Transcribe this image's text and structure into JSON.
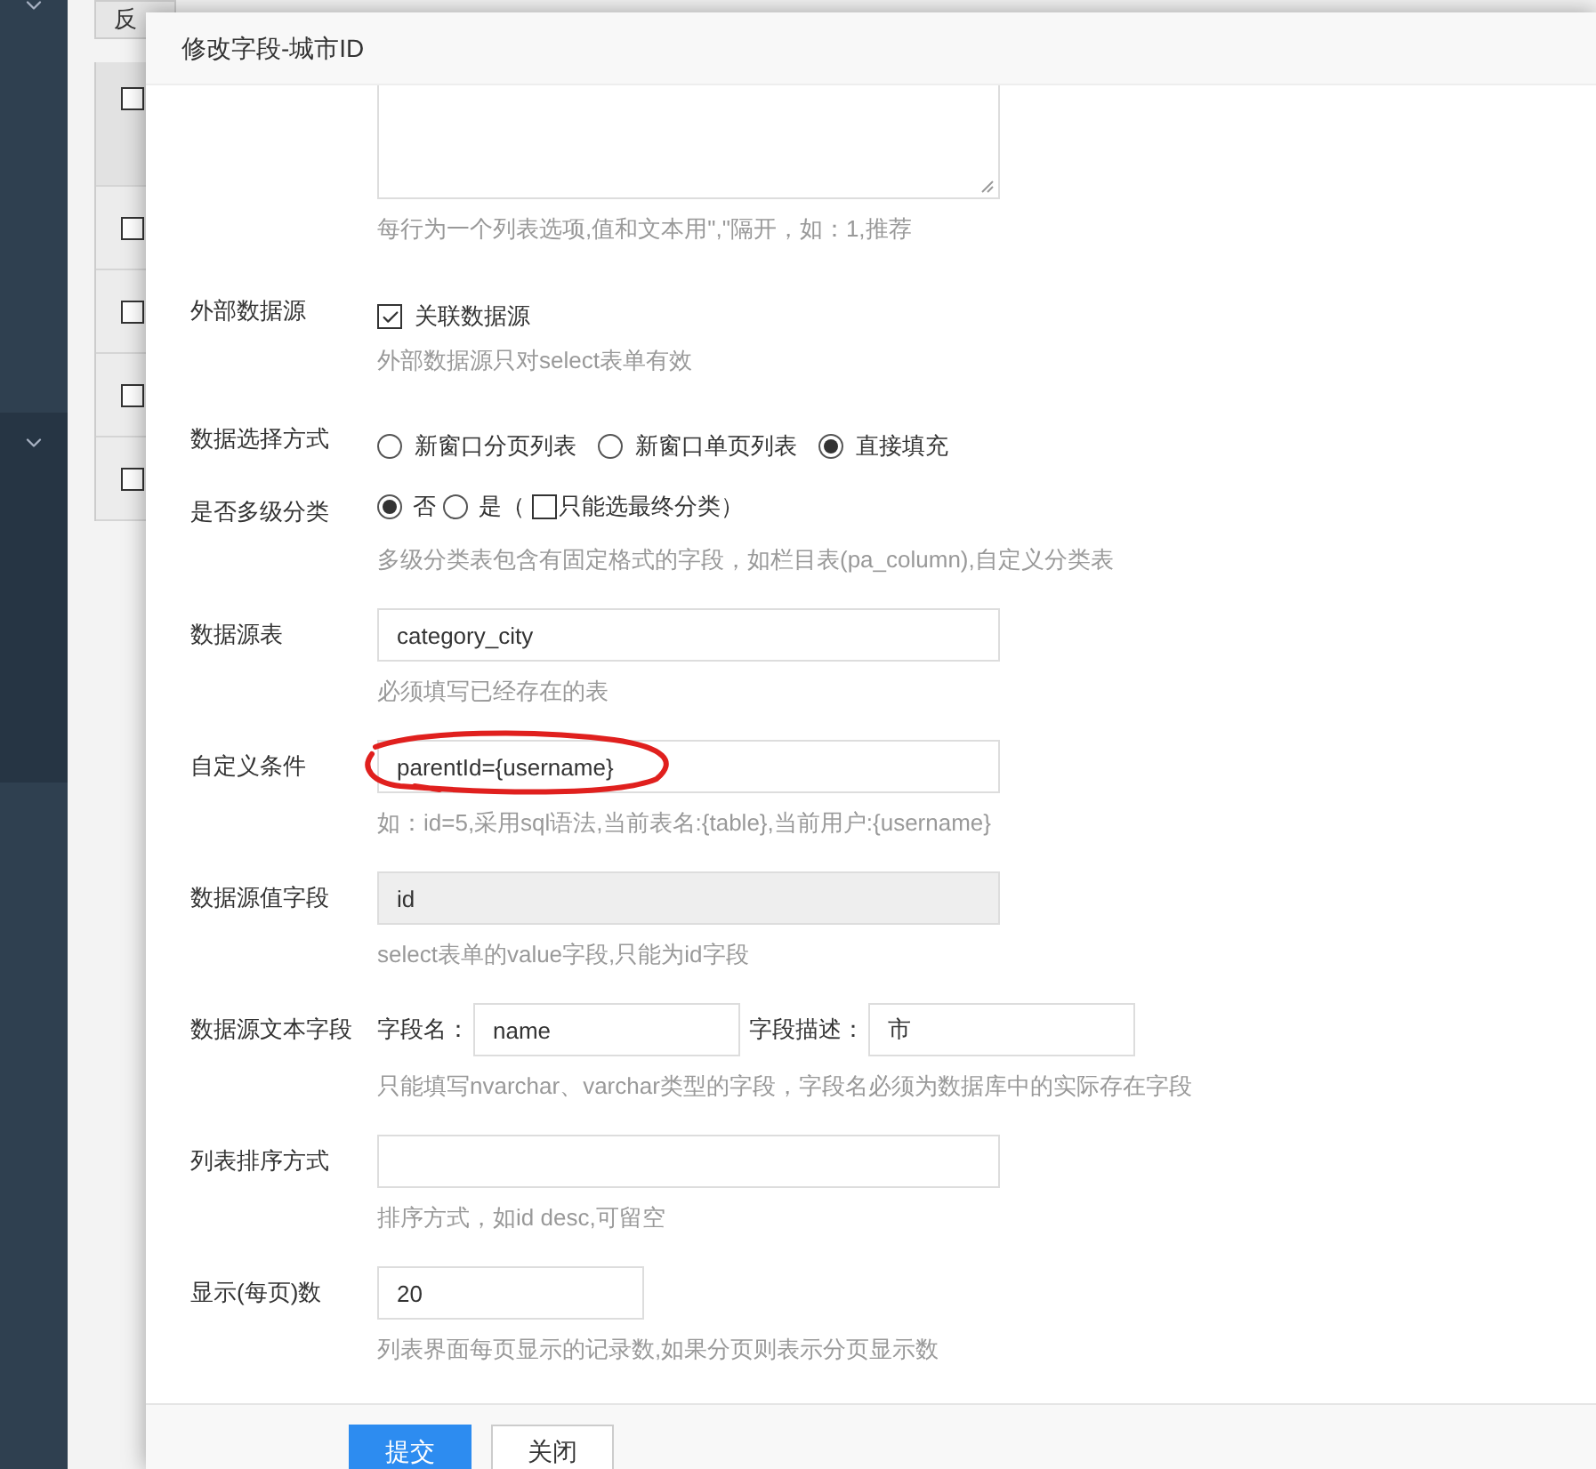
{
  "background": {
    "toolbar_button": "反",
    "table_checkboxes": [
      {
        "checked": false
      },
      {
        "checked": false
      },
      {
        "checked": false
      },
      {
        "checked": false
      },
      {
        "checked": false
      }
    ]
  },
  "dialog": {
    "title": "修改字段-城市ID",
    "fields": [
      {
        "kind": "textarea",
        "hint": "每行为一个列表选项,值和文本用\",\"隔开，如：1,推荐"
      },
      {
        "kind": "checkbox",
        "label": "外部数据源",
        "option": "关联数据源",
        "checked": true,
        "hint": "外部数据源只对select表单有效"
      },
      {
        "kind": "radio",
        "label": "数据选择方式",
        "options": [
          {
            "text": "新窗口分页列表",
            "selected": false
          },
          {
            "text": "新窗口单页列表",
            "selected": false
          },
          {
            "text": "直接填充",
            "selected": true
          }
        ]
      },
      {
        "kind": "multilevel",
        "label": "是否多级分类",
        "options": [
          {
            "text": "否",
            "selected": true
          },
          {
            "text": "是（",
            "selected": false
          }
        ],
        "suboption": {
          "text": "只能选最终分类）",
          "checked": false
        },
        "hint": "多级分类表包含有固定格式的字段，如栏目表(pa_column),自定义分类表"
      },
      {
        "kind": "text",
        "label": "数据源表",
        "value": "category_city",
        "hint": "必须填写已经存在的表"
      },
      {
        "kind": "text",
        "label": "自定义条件",
        "value": "parentId={username}",
        "annotated": true,
        "hint": "如：id=5,采用sql语法,当前表名:{table},当前用户:{username}"
      },
      {
        "kind": "text",
        "label": "数据源值字段",
        "value": "id",
        "disabled": true,
        "hint": "select表单的value字段,只能为id字段"
      },
      {
        "kind": "pair",
        "label": "数据源文本字段",
        "inputs": [
          {
            "label": "字段名：",
            "value": "name"
          },
          {
            "label": "字段描述：",
            "value": "市"
          }
        ],
        "hint": "只能填写nvarchar、varchar类型的字段，字段名必须为数据库中的实际存在字段"
      },
      {
        "kind": "text",
        "label": "列表排序方式",
        "hint": "排序方式，如id desc,可留空"
      },
      {
        "kind": "short",
        "label": "显示(每页)数",
        "value": "20",
        "hint": "列表界面每页显示的记录数,如果分页则表示分页显示数"
      }
    ],
    "buttons": [
      {
        "text": "提交",
        "primary": true
      },
      {
        "text": "关闭",
        "primary": false
      }
    ]
  }
}
